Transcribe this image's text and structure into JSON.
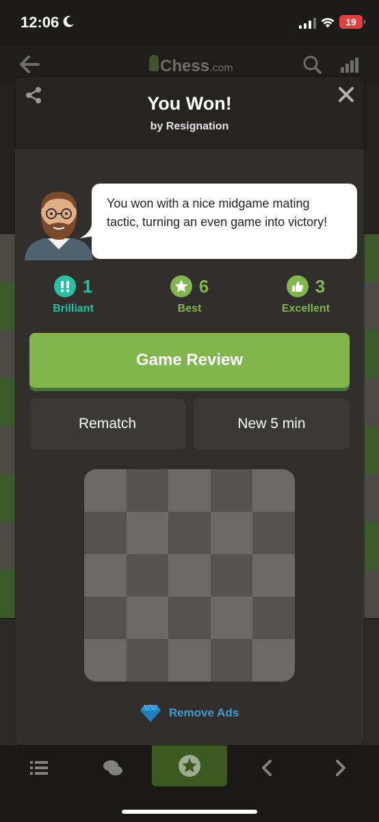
{
  "status_bar": {
    "time": "12:06",
    "battery": "19"
  },
  "app": {
    "logo_text": "Chess",
    "logo_suffix": ".com"
  },
  "modal": {
    "title": "You Won!",
    "subtitle": "by Resignation",
    "coach_message": "You won with a nice midgame mating tactic, turning an even game into victory!",
    "stats": [
      {
        "icon": "brilliant-icon",
        "symbol": "!!",
        "count": "1",
        "label": "Brilliant",
        "color": "#26c2a3"
      },
      {
        "icon": "best-star-icon",
        "symbol": "★",
        "count": "6",
        "label": "Best",
        "color": "#81b64c"
      },
      {
        "icon": "excellent-thumb-icon",
        "symbol": "👍",
        "count": "3",
        "label": "Excellent",
        "color": "#81b64c"
      }
    ],
    "game_review_label": "Game Review",
    "rematch_label": "Rematch",
    "new_game_label": "New 5 min",
    "remove_ads_label": "Remove Ads"
  },
  "colors": {
    "primary_green": "#81b64c",
    "brilliant_teal": "#26c2a3",
    "remove_ads_blue": "#3e9dd1",
    "modal_bg": "#312e2b"
  }
}
